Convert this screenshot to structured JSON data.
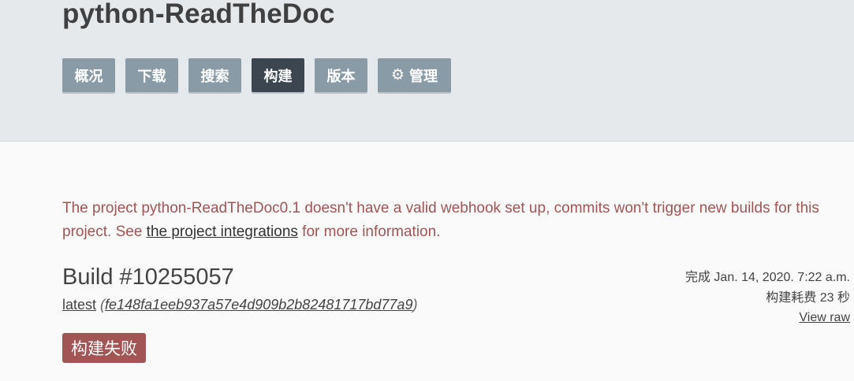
{
  "project": {
    "title": "python-ReadTheDoc"
  },
  "nav": {
    "overview": "概况",
    "downloads": "下载",
    "search": "搜索",
    "builds": "构建",
    "versions": "版本",
    "admin": "管理",
    "admin_icon": "gear-icon",
    "active_color": "#3b4650",
    "inactive_color": "#8a9ba8"
  },
  "notice": {
    "before": "The project python-ReadTheDoc0.1 doesn't have a valid webhook set up, commits won't trigger new builds for this project. See ",
    "link": "the project integrations",
    "after": " for more information.",
    "color": "#a15555"
  },
  "build": {
    "title": "Build #10255057",
    "version": "latest",
    "open_paren": "(",
    "commit": "fe148fa1eeb937a57e4d909b2b82481717bd77a9",
    "close_paren": ")",
    "finished": "完成 Jan. 14, 2020. 7:22 a.m.",
    "duration": "构建耗费 23 秒",
    "view_raw": "View raw",
    "status": "构建失败",
    "status_color": "#a15555"
  }
}
